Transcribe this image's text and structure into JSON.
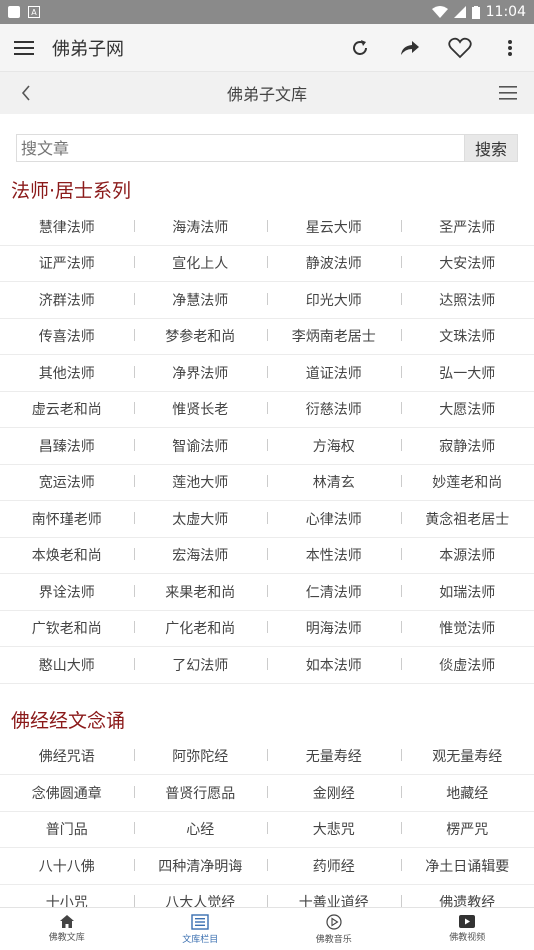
{
  "status": {
    "time": "11:04"
  },
  "appbar": {
    "title": "佛弟子网"
  },
  "subbar": {
    "title": "佛弟子文库"
  },
  "search": {
    "placeholder": "搜文章",
    "button": "搜索"
  },
  "section1": {
    "title": "法师·居士系列",
    "rows": [
      [
        "慧律法师",
        "海涛法师",
        "星云大师",
        "圣严法师"
      ],
      [
        "证严法师",
        "宣化上人",
        "静波法师",
        "大安法师"
      ],
      [
        "济群法师",
        "净慧法师",
        "印光大师",
        "达照法师"
      ],
      [
        "传喜法师",
        "梦参老和尚",
        "李炳南老居士",
        "文珠法师"
      ],
      [
        "其他法师",
        "净界法师",
        "道证法师",
        "弘一大师"
      ],
      [
        "虚云老和尚",
        "惟贤长老",
        "衍慈法师",
        "大愿法师"
      ],
      [
        "昌臻法师",
        "智谕法师",
        "方海权",
        "寂静法师"
      ],
      [
        "宽运法师",
        "莲池大师",
        "林清玄",
        "妙莲老和尚"
      ],
      [
        "南怀瑾老师",
        "太虚大师",
        "心律法师",
        "黄念祖老居士"
      ],
      [
        "本焕老和尚",
        "宏海法师",
        "本性法师",
        "本源法师"
      ],
      [
        "界诠法师",
        "来果老和尚",
        "仁清法师",
        "如瑞法师"
      ],
      [
        "广钦老和尚",
        "广化老和尚",
        "明海法师",
        "惟觉法师"
      ],
      [
        "憨山大师",
        "了幻法师",
        "如本法师",
        "倓虚法师"
      ]
    ]
  },
  "section2": {
    "title": "佛经经文念诵",
    "rows": [
      [
        "佛经咒语",
        "阿弥陀经",
        "无量寿经",
        "观无量寿经"
      ],
      [
        "念佛圆通章",
        "普贤行愿品",
        "金刚经",
        "地藏经"
      ],
      [
        "普门品",
        "心经",
        "大悲咒",
        "楞严咒"
      ],
      [
        "八十八佛",
        "四种清净明诲",
        "药师经",
        "净土日诵辑要"
      ],
      [
        "十小咒",
        "八大人觉经",
        "十善业道经",
        "佛遗教经"
      ]
    ]
  },
  "tabs": [
    {
      "label": "佛教文库",
      "icon": "home-icon"
    },
    {
      "label": "文库栏目",
      "icon": "list-icon"
    },
    {
      "label": "佛教音乐",
      "icon": "play-circle-icon"
    },
    {
      "label": "佛教视频",
      "icon": "video-icon"
    }
  ],
  "colors": {
    "section_title": "#8b1a1a",
    "tab_active": "#3a6fb0"
  }
}
